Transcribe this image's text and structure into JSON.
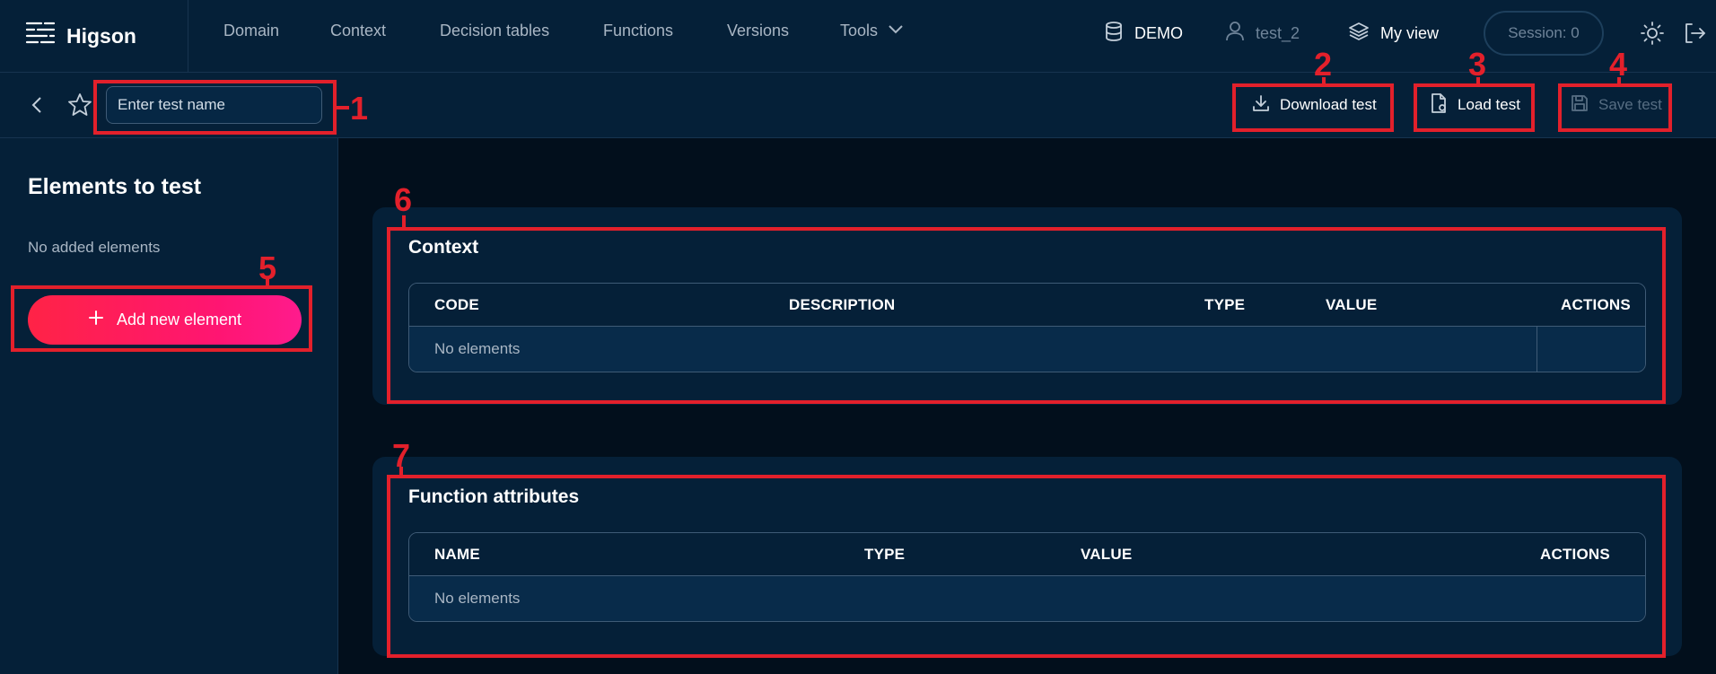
{
  "app": {
    "name": "Higson"
  },
  "nav": {
    "items": [
      "Domain",
      "Context",
      "Decision tables",
      "Functions",
      "Versions"
    ],
    "tools_label": "Tools"
  },
  "header_right": {
    "environment": "DEMO",
    "user": "test_2",
    "view": "My view",
    "session": "Session: 0"
  },
  "toolbar": {
    "test_name_placeholder": "Enter test name",
    "download_label": "Download test",
    "load_label": "Load test",
    "save_label": "Save test"
  },
  "sidebar": {
    "title": "Elements to test",
    "empty_text": "No added elements",
    "add_button_label": "Add new element"
  },
  "context_card": {
    "title": "Context",
    "columns": [
      "CODE",
      "DESCRIPTION",
      "TYPE",
      "VALUE",
      "ACTIONS"
    ],
    "empty_text": "No elements"
  },
  "function_card": {
    "title": "Function attributes",
    "columns": [
      "NAME",
      "TYPE",
      "VALUE",
      "ACTIONS"
    ],
    "empty_text": "No elements"
  },
  "annotations": [
    "1",
    "2",
    "3",
    "4",
    "5",
    "6",
    "7"
  ],
  "colors": {
    "background": "#020f1c",
    "panel": "#052038",
    "accent_gradient_start": "#ff2346",
    "accent_gradient_end": "#ff1b8d",
    "annotation_red": "#e3202b"
  }
}
